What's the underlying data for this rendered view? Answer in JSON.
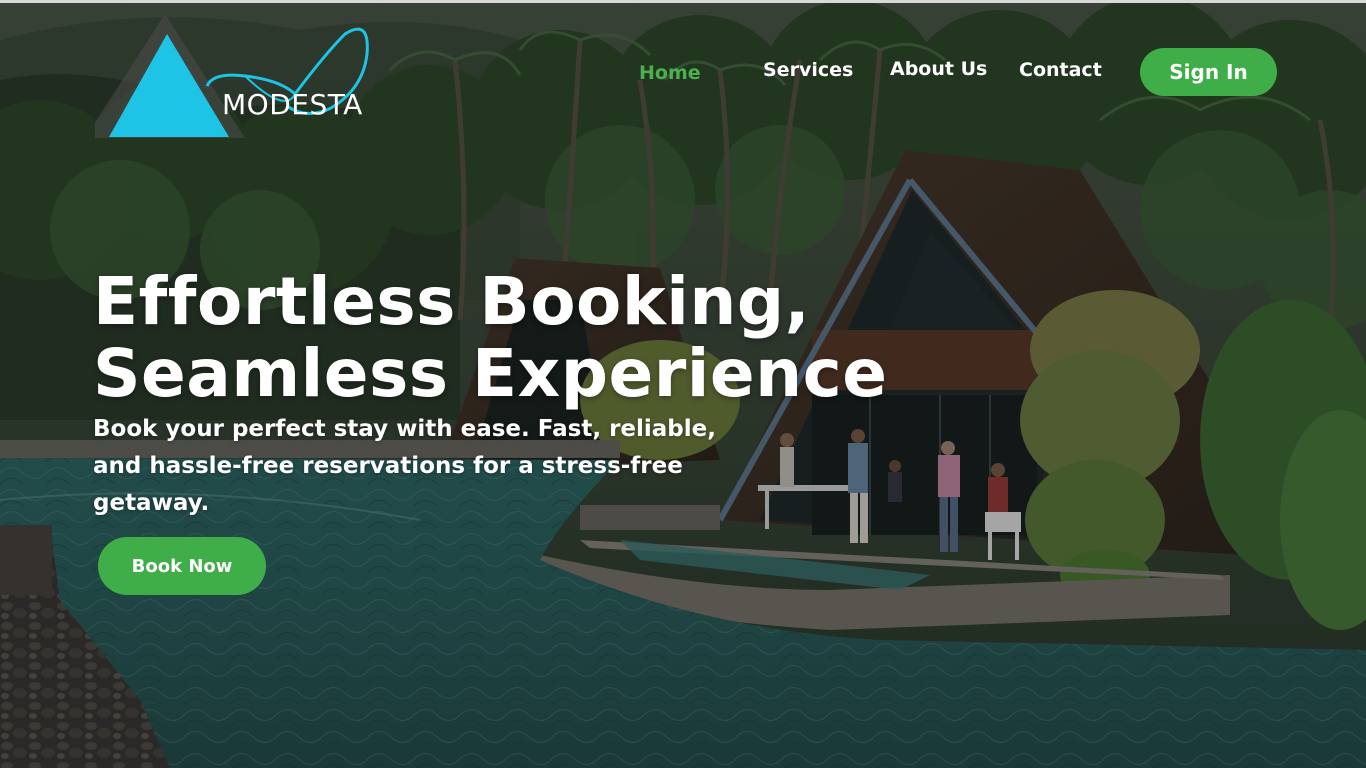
{
  "brand": {
    "name": "MODESTA",
    "triangle_color": "#1ec4e6",
    "swoosh_color": "#1ec4e6"
  },
  "nav": {
    "items": [
      {
        "label": "Home",
        "active": true
      },
      {
        "label": "Services",
        "active": false
      },
      {
        "label": "About Us",
        "active": false
      },
      {
        "label": "Contact",
        "active": false
      }
    ],
    "signin_label": "Sign In"
  },
  "hero": {
    "headline_line1": "Effortless Booking,",
    "headline_line2": "Seamless Experience",
    "subtext": "Book your perfect stay with ease. Fast, reliable, and hassle-free reservations for a stress-free getaway.",
    "cta_label": "Book Now",
    "background_image": "resort-pool-with-thatched-a-frame-houses-and-palm-trees"
  },
  "colors": {
    "accent_green": "#3fae49",
    "active_nav_green": "#4cb04f",
    "text": "#ffffff"
  }
}
